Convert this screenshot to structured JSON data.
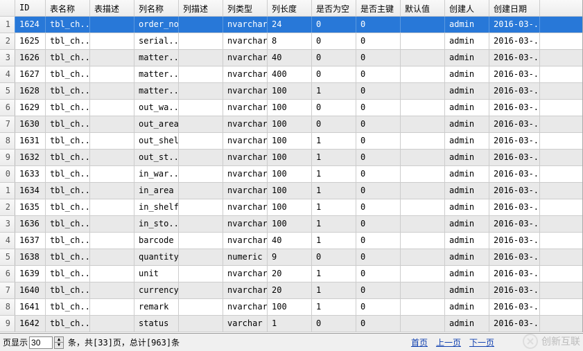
{
  "columns": {
    "id": "ID",
    "table_name": "表名称",
    "table_desc": "表描述",
    "col_name": "列名称",
    "col_desc": "列描述",
    "col_type": "列类型",
    "col_len": "列长度",
    "nullable": "是否为空",
    "pk": "是否主键",
    "default": "默认值",
    "creator": "创建人",
    "cdate": "创建日期"
  },
  "rows": [
    {
      "n": "1",
      "id": "1624",
      "tbl": "tbl_ch...",
      "tdesc": "",
      "cname": "order_no",
      "cdesc": "",
      "ctype": "nvarchar",
      "clen": "24",
      "null": "0",
      "pk": "0",
      "def": "",
      "crt": "admin",
      "cdate": "2016-03-..."
    },
    {
      "n": "2",
      "id": "1625",
      "tbl": "tbl_ch...",
      "tdesc": "",
      "cname": "serial...",
      "cdesc": "",
      "ctype": "nvarchar",
      "clen": "8",
      "null": "0",
      "pk": "0",
      "def": "",
      "crt": "admin",
      "cdate": "2016-03-..."
    },
    {
      "n": "3",
      "id": "1626",
      "tbl": "tbl_ch...",
      "tdesc": "",
      "cname": "matter...",
      "cdesc": "",
      "ctype": "nvarchar",
      "clen": "40",
      "null": "0",
      "pk": "0",
      "def": "",
      "crt": "admin",
      "cdate": "2016-03-..."
    },
    {
      "n": "4",
      "id": "1627",
      "tbl": "tbl_ch...",
      "tdesc": "",
      "cname": "matter...",
      "cdesc": "",
      "ctype": "nvarchar",
      "clen": "400",
      "null": "0",
      "pk": "0",
      "def": "",
      "crt": "admin",
      "cdate": "2016-03-..."
    },
    {
      "n": "5",
      "id": "1628",
      "tbl": "tbl_ch...",
      "tdesc": "",
      "cname": "matter...",
      "cdesc": "",
      "ctype": "nvarchar",
      "clen": "100",
      "null": "1",
      "pk": "0",
      "def": "",
      "crt": "admin",
      "cdate": "2016-03-..."
    },
    {
      "n": "6",
      "id": "1629",
      "tbl": "tbl_ch...",
      "tdesc": "",
      "cname": "out_wa...",
      "cdesc": "",
      "ctype": "nvarchar",
      "clen": "100",
      "null": "0",
      "pk": "0",
      "def": "",
      "crt": "admin",
      "cdate": "2016-03-..."
    },
    {
      "n": "7",
      "id": "1630",
      "tbl": "tbl_ch...",
      "tdesc": "",
      "cname": "out_area",
      "cdesc": "",
      "ctype": "nvarchar",
      "clen": "100",
      "null": "0",
      "pk": "0",
      "def": "",
      "crt": "admin",
      "cdate": "2016-03-..."
    },
    {
      "n": "8",
      "id": "1631",
      "tbl": "tbl_ch...",
      "tdesc": "",
      "cname": "out_shelf",
      "cdesc": "",
      "ctype": "nvarchar",
      "clen": "100",
      "null": "1",
      "pk": "0",
      "def": "",
      "crt": "admin",
      "cdate": "2016-03-..."
    },
    {
      "n": "9",
      "id": "1632",
      "tbl": "tbl_ch...",
      "tdesc": "",
      "cname": "out_st...",
      "cdesc": "",
      "ctype": "nvarchar",
      "clen": "100",
      "null": "1",
      "pk": "0",
      "def": "",
      "crt": "admin",
      "cdate": "2016-03-..."
    },
    {
      "n": "0",
      "id": "1633",
      "tbl": "tbl_ch...",
      "tdesc": "",
      "cname": "in_war...",
      "cdesc": "",
      "ctype": "nvarchar",
      "clen": "100",
      "null": "1",
      "pk": "0",
      "def": "",
      "crt": "admin",
      "cdate": "2016-03-..."
    },
    {
      "n": "1",
      "id": "1634",
      "tbl": "tbl_ch...",
      "tdesc": "",
      "cname": "in_area",
      "cdesc": "",
      "ctype": "nvarchar",
      "clen": "100",
      "null": "1",
      "pk": "0",
      "def": "",
      "crt": "admin",
      "cdate": "2016-03-..."
    },
    {
      "n": "2",
      "id": "1635",
      "tbl": "tbl_ch...",
      "tdesc": "",
      "cname": "in_shelf",
      "cdesc": "",
      "ctype": "nvarchar",
      "clen": "100",
      "null": "1",
      "pk": "0",
      "def": "",
      "crt": "admin",
      "cdate": "2016-03-..."
    },
    {
      "n": "3",
      "id": "1636",
      "tbl": "tbl_ch...",
      "tdesc": "",
      "cname": "in_sto...",
      "cdesc": "",
      "ctype": "nvarchar",
      "clen": "100",
      "null": "1",
      "pk": "0",
      "def": "",
      "crt": "admin",
      "cdate": "2016-03-..."
    },
    {
      "n": "4",
      "id": "1637",
      "tbl": "tbl_ch...",
      "tdesc": "",
      "cname": "barcode",
      "cdesc": "",
      "ctype": "nvarchar",
      "clen": "40",
      "null": "1",
      "pk": "0",
      "def": "",
      "crt": "admin",
      "cdate": "2016-03-..."
    },
    {
      "n": "5",
      "id": "1638",
      "tbl": "tbl_ch...",
      "tdesc": "",
      "cname": "quantity",
      "cdesc": "",
      "ctype": "numeric",
      "clen": "9",
      "null": "0",
      "pk": "0",
      "def": "",
      "crt": "admin",
      "cdate": "2016-03-..."
    },
    {
      "n": "6",
      "id": "1639",
      "tbl": "tbl_ch...",
      "tdesc": "",
      "cname": "unit",
      "cdesc": "",
      "ctype": "nvarchar",
      "clen": "20",
      "null": "1",
      "pk": "0",
      "def": "",
      "crt": "admin",
      "cdate": "2016-03-..."
    },
    {
      "n": "7",
      "id": "1640",
      "tbl": "tbl_ch...",
      "tdesc": "",
      "cname": "currency",
      "cdesc": "",
      "ctype": "nvarchar",
      "clen": "20",
      "null": "1",
      "pk": "0",
      "def": "",
      "crt": "admin",
      "cdate": "2016-03-..."
    },
    {
      "n": "8",
      "id": "1641",
      "tbl": "tbl_ch...",
      "tdesc": "",
      "cname": "remark",
      "cdesc": "",
      "ctype": "nvarchar",
      "clen": "100",
      "null": "1",
      "pk": "0",
      "def": "",
      "crt": "admin",
      "cdate": "2016-03-..."
    },
    {
      "n": "9",
      "id": "1642",
      "tbl": "tbl_ch...",
      "tdesc": "",
      "cname": "status",
      "cdesc": "",
      "ctype": "varchar",
      "clen": "1",
      "null": "0",
      "pk": "0",
      "def": "",
      "crt": "admin",
      "cdate": "2016-03-..."
    }
  ],
  "selected_index": 0,
  "footer": {
    "per_page_label": "页显示",
    "per_page_value": "30",
    "summary_prefix": "条，共[",
    "total_pages": "33",
    "summary_mid": "]页，总计[",
    "total_rows": "963",
    "summary_suffix": "]条",
    "nav_first": "首页",
    "nav_prev": "上一页",
    "nav_next": "下一页",
    "watermark": "创新互联"
  }
}
